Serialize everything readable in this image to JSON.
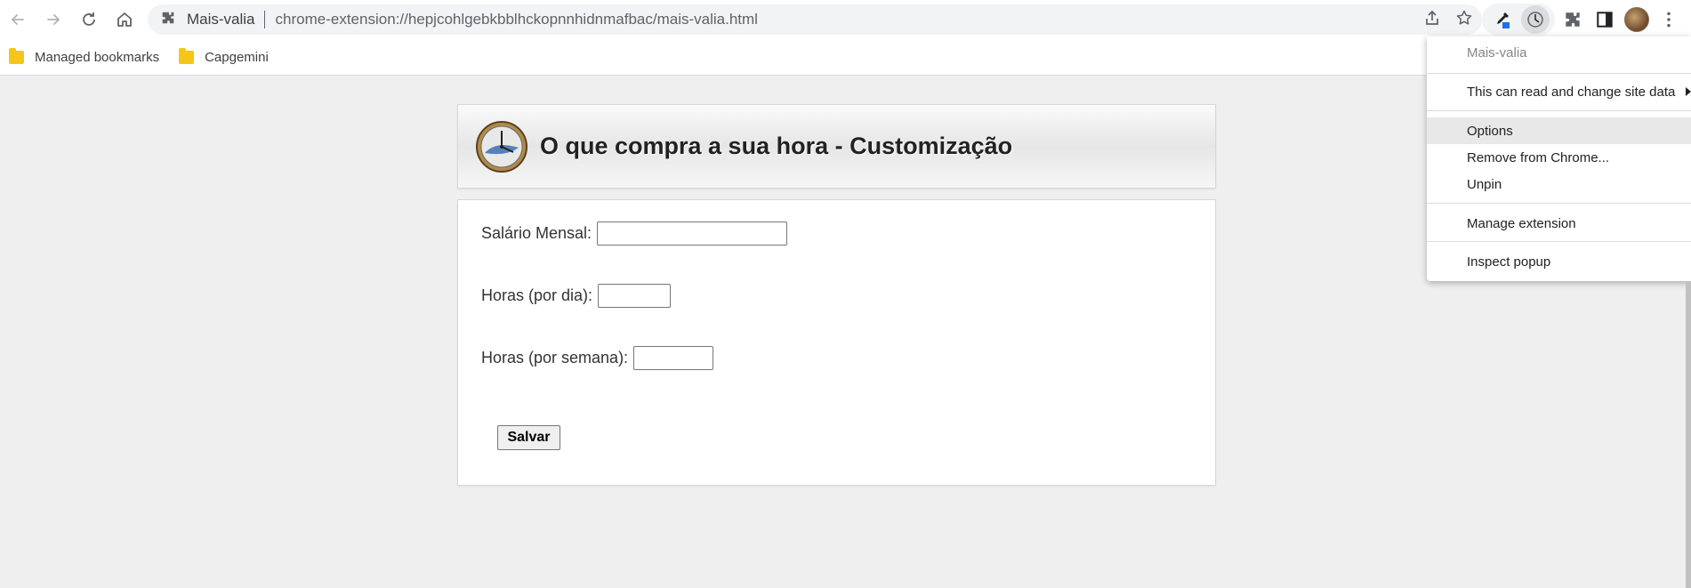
{
  "toolbar": {
    "site_name": "Mais-valia",
    "url": "chrome-extension://hepjcohlgebkbblhckopnnhidnmafbac/mais-valia.html"
  },
  "bookmarks": [
    {
      "label": "Managed bookmarks"
    },
    {
      "label": "Capgemini"
    }
  ],
  "page": {
    "title": "O que compra a sua hora - Customização",
    "fields": {
      "salary_label": "Salário Mensal:",
      "salary_value": "",
      "hours_day_label": "Horas (por dia):",
      "hours_day_value": "",
      "hours_week_label": "Horas (por semana):",
      "hours_week_value": ""
    },
    "save_label": "Salvar"
  },
  "context_menu": {
    "header": "Mais-valia",
    "site_access": "This can read and change site data",
    "options": "Options",
    "remove": "Remove from Chrome...",
    "unpin": "Unpin",
    "manage": "Manage extension",
    "inspect": "Inspect popup"
  },
  "colors": {
    "accent_blue": "#1a73e8",
    "folder_yellow": "#f5c518",
    "page_bg": "#efefef"
  }
}
